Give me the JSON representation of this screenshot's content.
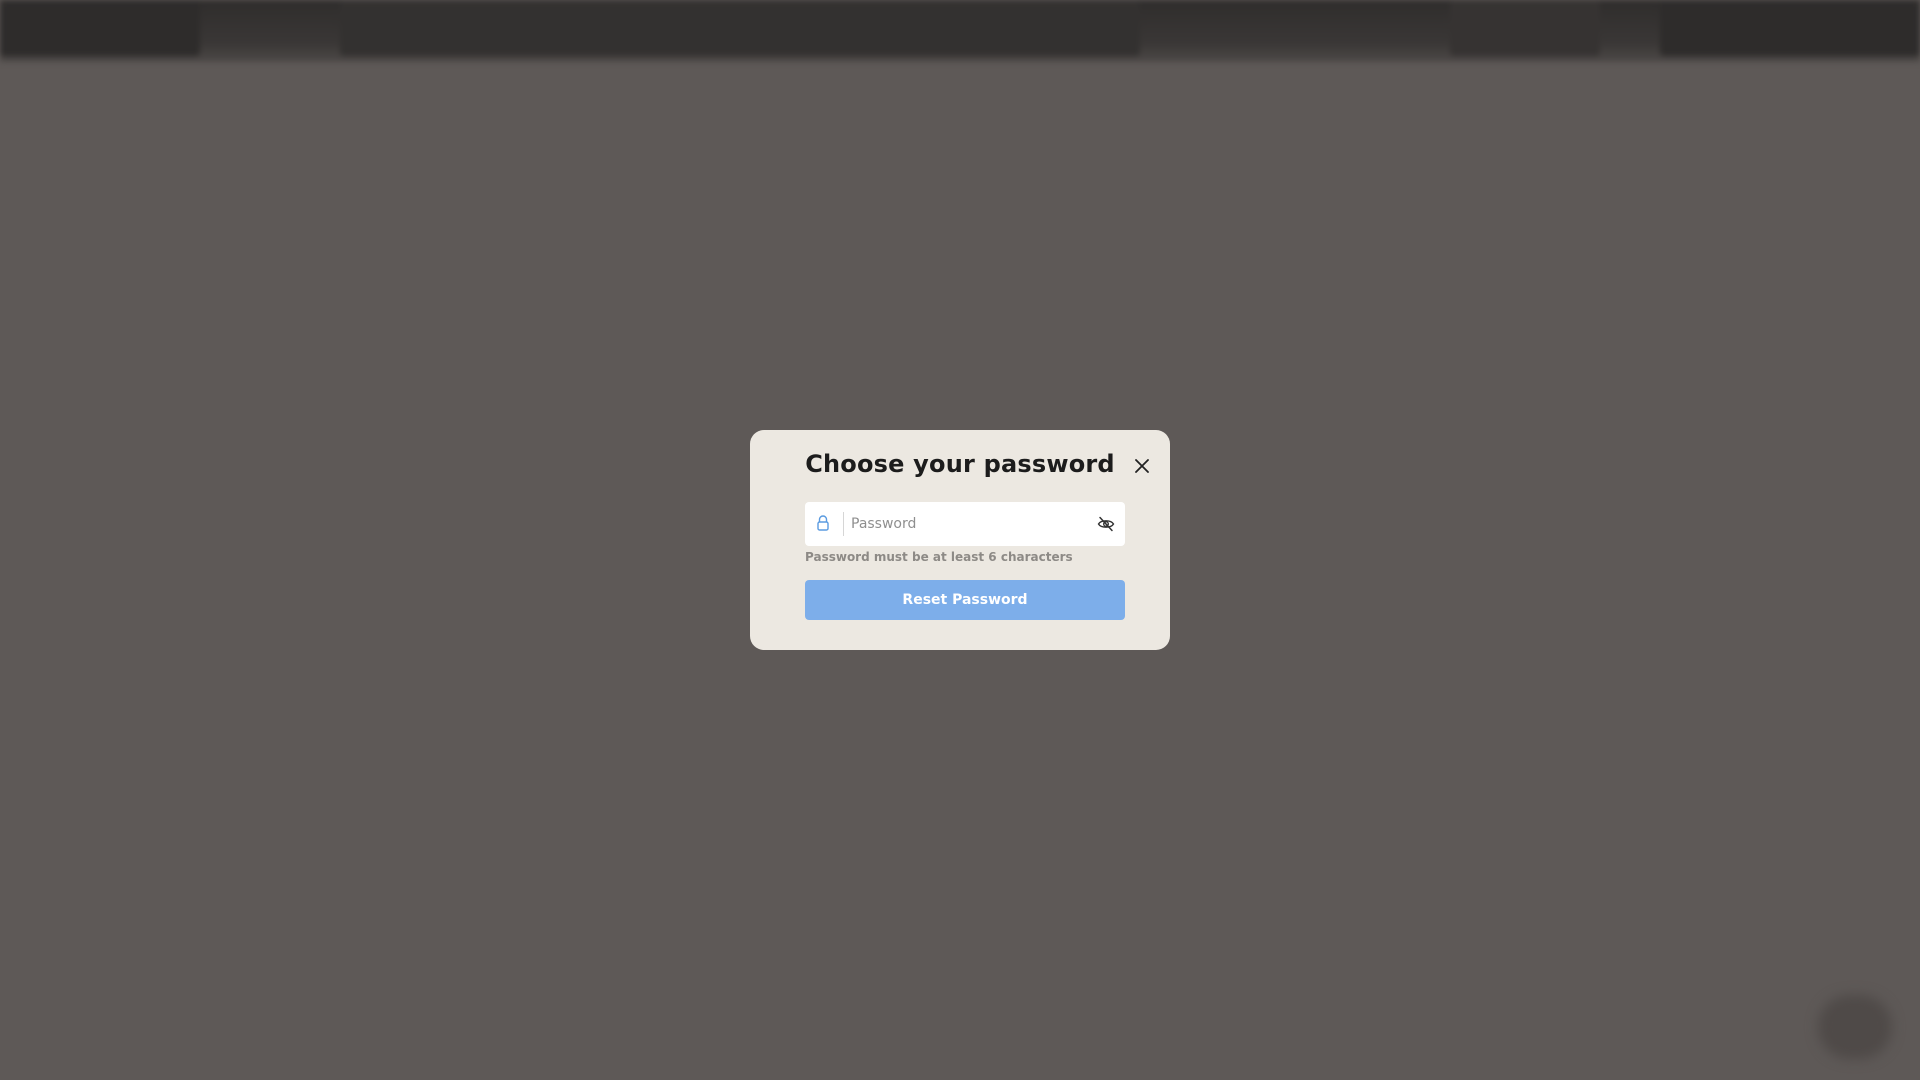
{
  "modal": {
    "title": "Choose your password",
    "password_field": {
      "placeholder": "Password",
      "value": ""
    },
    "hint": "Password must be at least 6 characters",
    "submit_label": "Reset Password"
  },
  "colors": {
    "backdrop": "#5e5957",
    "modal_background": "#ece8e1",
    "accent_button": "#7daeea",
    "lock_icon": "#5b9be0"
  },
  "icons": {
    "close": "close-icon",
    "lock": "lock-icon",
    "visibility": "eye-off-icon"
  }
}
